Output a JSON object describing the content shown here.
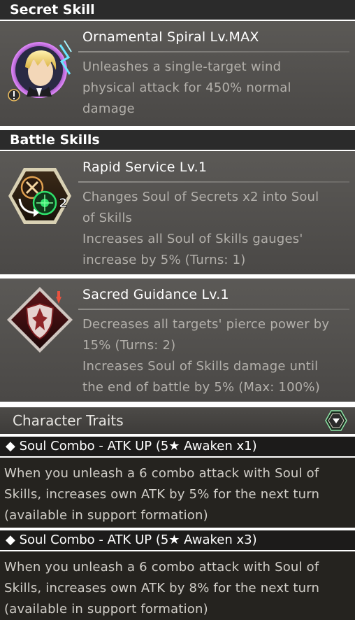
{
  "secret_skill": {
    "header": "Secret Skill",
    "name": "Ornamental Spiral Lv.MAX",
    "desc_lines": [
      "Unleashes a single-target wind",
      "physical attack for 450% normal",
      "damage"
    ]
  },
  "battle_skills": {
    "header": "Battle Skills",
    "items": [
      {
        "name": "Rapid Service Lv.1",
        "icon": "soul-exchange-icon",
        "desc_lines": [
          "Changes Soul of Secrets x2 into Soul",
          "of Skills",
          "Increases all Soul of Skills gauges'",
          "increase by 5% (Turns: 1)"
        ],
        "icon_badge": "2"
      },
      {
        "name": "Sacred Guidance Lv.1",
        "icon": "shield-debuff-icon",
        "desc_lines": [
          "Decreases all targets' pierce power by",
          "15% (Turns: 2)",
          "Increases Soul of Skills damage until",
          "the end of battle by 5% (Max: 100%)"
        ]
      }
    ]
  },
  "traits": {
    "header": "Character Traits",
    "items": [
      {
        "title": "◆ Soul Combo - ATK UP (5★ Awaken x1)",
        "desc_lines": [
          "When you unleash a 6 combo attack with Soul of",
          "Skills, increases own ATK by 5% for the next turn",
          "(available in support formation)"
        ]
      },
      {
        "title": "◆ Soul Combo - ATK UP (5★ Awaken x3)",
        "desc_lines": [
          "When you unleash a 6 combo attack with Soul of",
          "Skills, increases own ATK by 8% for the next turn",
          "(available in support formation)"
        ]
      }
    ]
  },
  "colors": {
    "accent_green": "#2ee06a",
    "accent_red": "#c4282b",
    "accent_gold": "#d8b25a"
  }
}
